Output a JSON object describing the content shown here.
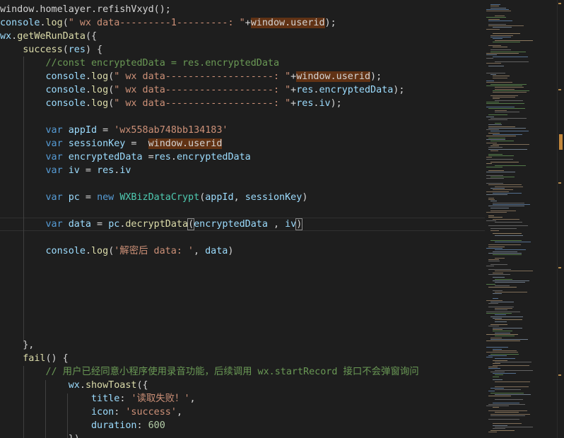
{
  "editor": {
    "lines": [
      [
        [
          "p",
          "window.homelayer.refishVxyd();"
        ]
      ],
      [
        [
          "v",
          "console"
        ],
        [
          "p",
          "."
        ],
        [
          "f",
          "log"
        ],
        [
          "p",
          "("
        ],
        [
          "s",
          "\" wx data---------1---------: \""
        ],
        [
          "p",
          "+"
        ],
        [
          "hl",
          "window.userid"
        ],
        [
          "p",
          ");"
        ]
      ],
      [
        [
          "v",
          "wx"
        ],
        [
          "p",
          "."
        ],
        [
          "f",
          "getWeRunData"
        ],
        [
          "p",
          "({"
        ]
      ],
      [
        [
          "p",
          "    "
        ],
        [
          "f",
          "success"
        ],
        [
          "p",
          "("
        ],
        [
          "v",
          "res"
        ],
        [
          "p",
          ") {"
        ]
      ],
      [
        [
          "p",
          "        "
        ],
        [
          "c",
          "//const encryptedData = res.encryptedData"
        ]
      ],
      [
        [
          "p",
          "        "
        ],
        [
          "v",
          "console"
        ],
        [
          "p",
          "."
        ],
        [
          "f",
          "log"
        ],
        [
          "p",
          "("
        ],
        [
          "s",
          "\" wx data-------------------: \""
        ],
        [
          "p",
          "+"
        ],
        [
          "hl",
          "window.userid"
        ],
        [
          "p",
          ");"
        ]
      ],
      [
        [
          "p",
          "        "
        ],
        [
          "v",
          "console"
        ],
        [
          "p",
          "."
        ],
        [
          "f",
          "log"
        ],
        [
          "p",
          "("
        ],
        [
          "s",
          "\" wx data-------------------: \""
        ],
        [
          "p",
          "+"
        ],
        [
          "v",
          "res"
        ],
        [
          "p",
          "."
        ],
        [
          "v",
          "encryptedData"
        ],
        [
          "p",
          ");"
        ]
      ],
      [
        [
          "p",
          "        "
        ],
        [
          "v",
          "console"
        ],
        [
          "p",
          "."
        ],
        [
          "f",
          "log"
        ],
        [
          "p",
          "("
        ],
        [
          "s",
          "\" wx data-------------------: \""
        ],
        [
          "p",
          "+"
        ],
        [
          "v",
          "res"
        ],
        [
          "p",
          "."
        ],
        [
          "v",
          "iv"
        ],
        [
          "p",
          ");"
        ]
      ],
      [],
      [
        [
          "p",
          "        "
        ],
        [
          "k",
          "var"
        ],
        [
          "p",
          " "
        ],
        [
          "v",
          "appId"
        ],
        [
          "p",
          " = "
        ],
        [
          "s",
          "'wx558ab748bb134183'"
        ]
      ],
      [
        [
          "p",
          "        "
        ],
        [
          "k",
          "var"
        ],
        [
          "p",
          " "
        ],
        [
          "v",
          "sessionKey"
        ],
        [
          "p",
          " =  "
        ],
        [
          "hl",
          "window.userid"
        ]
      ],
      [
        [
          "p",
          "        "
        ],
        [
          "k",
          "var"
        ],
        [
          "p",
          " "
        ],
        [
          "v",
          "encryptedData"
        ],
        [
          "p",
          " ="
        ],
        [
          "v",
          "res"
        ],
        [
          "p",
          "."
        ],
        [
          "v",
          "encryptedData"
        ]
      ],
      [
        [
          "p",
          "        "
        ],
        [
          "k",
          "var"
        ],
        [
          "p",
          " "
        ],
        [
          "v",
          "iv"
        ],
        [
          "p",
          " = "
        ],
        [
          "v",
          "res"
        ],
        [
          "p",
          "."
        ],
        [
          "v",
          "iv"
        ]
      ],
      [],
      [
        [
          "p",
          "        "
        ],
        [
          "k",
          "var"
        ],
        [
          "p",
          " "
        ],
        [
          "v",
          "pc"
        ],
        [
          "p",
          " = "
        ],
        [
          "k",
          "new"
        ],
        [
          "p",
          " "
        ],
        [
          "cl",
          "WXBizDataCrypt"
        ],
        [
          "p",
          "("
        ],
        [
          "v",
          "appId"
        ],
        [
          "p",
          ", "
        ],
        [
          "v",
          "sessionKey"
        ],
        [
          "p",
          ")"
        ]
      ],
      [],
      [
        [
          "p",
          "        "
        ],
        [
          "k",
          "var"
        ],
        [
          "p",
          " "
        ],
        [
          "v",
          "data"
        ],
        [
          "p",
          " = "
        ],
        [
          "v",
          "pc"
        ],
        [
          "p",
          "."
        ],
        [
          "f",
          "decryptData"
        ],
        [
          "bm",
          "("
        ],
        [
          "v",
          "encryptedData"
        ],
        [
          "p",
          " , "
        ],
        [
          "v",
          "iv"
        ],
        [
          "bm",
          ")"
        ]
      ],
      [],
      [
        [
          "p",
          "        "
        ],
        [
          "v",
          "console"
        ],
        [
          "p",
          "."
        ],
        [
          "f",
          "log"
        ],
        [
          "p",
          "("
        ],
        [
          "s",
          "'解密后 data: '"
        ],
        [
          "p",
          ", "
        ],
        [
          "v",
          "data"
        ],
        [
          "p",
          ")"
        ]
      ],
      [],
      [],
      [],
      [],
      [],
      [],
      [
        [
          "p",
          "    },"
        ]
      ],
      [
        [
          "p",
          "    "
        ],
        [
          "f",
          "fail"
        ],
        [
          "p",
          "() {"
        ]
      ],
      [
        [
          "p",
          "        "
        ],
        [
          "c",
          "// 用户已经同意小程序使用录音功能，后续调用 wx.startRecord 接口不会弹窗询问"
        ]
      ],
      [
        [
          "p",
          "            "
        ],
        [
          "v",
          "wx"
        ],
        [
          "p",
          "."
        ],
        [
          "f",
          "showToast"
        ],
        [
          "p",
          "({"
        ]
      ],
      [
        [
          "p",
          "                "
        ],
        [
          "v",
          "title"
        ],
        [
          "p",
          ": "
        ],
        [
          "s",
          "'读取失败！'"
        ],
        [
          "p",
          ","
        ]
      ],
      [
        [
          "p",
          "                "
        ],
        [
          "v",
          "icon"
        ],
        [
          "p",
          ": "
        ],
        [
          "s",
          "'success'"
        ],
        [
          "p",
          ","
        ]
      ],
      [
        [
          "p",
          "                "
        ],
        [
          "v",
          "duration"
        ],
        [
          "p",
          ": "
        ],
        [
          "n",
          "600"
        ]
      ],
      [
        [
          "p",
          "            "
        ],
        [
          "p",
          "})"
        ]
      ]
    ]
  }
}
